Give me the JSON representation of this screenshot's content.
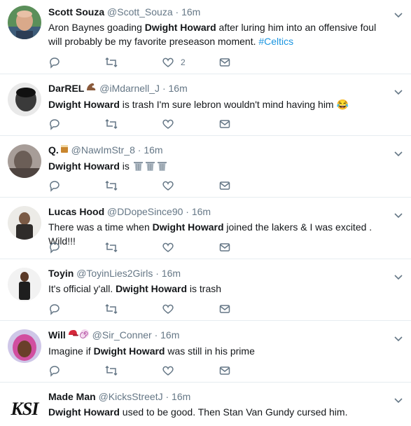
{
  "tweets": [
    {
      "name": "Scott Souza",
      "handle": "@Scott_Souza",
      "time": "16m",
      "text_parts": [
        "Aron Baynes goading ",
        "Dwight Howard",
        " after luring him into an offensive foul will probably be my favorite preseason moment. ",
        "#Celtics"
      ],
      "like_count": "2",
      "avatar": "avatar-bald-man"
    },
    {
      "name": "DarREL",
      "name_emoji": "muscle-emoji",
      "handle": "@iMdarnell_J",
      "time": "16m",
      "text_parts": [
        "Dwight Howard",
        " is trash I'm sure lebron wouldn't mind having him ",
        "😂"
      ],
      "avatar": "avatar-bw-man"
    },
    {
      "name": "Q.",
      "name_emoji": "drink-emoji",
      "handle": "@NawImStr_8",
      "time": "16m",
      "text_parts": [
        "Dwight Howard",
        " is "
      ],
      "trash_emoji_count": 3,
      "avatar": "avatar-blurry-man"
    },
    {
      "name": "Lucas Hood",
      "handle": "@DDopeSince90",
      "time": "16m",
      "text_parts": [
        "There was a time when ",
        "Dwight Howard",
        " joined the lakers & I was excited . Wild!!!"
      ],
      "avatar": "avatar-seated-man"
    },
    {
      "name": "Toyin",
      "handle": "@ToyinLies2Girls",
      "time": "16m",
      "text_parts": [
        "It's official y'all. ",
        "Dwight Howard",
        " is trash"
      ],
      "avatar": "avatar-standing-man"
    },
    {
      "name": "Will",
      "name_emoji": "baseball-cap-emoji",
      "handle": "@Sir_Conner",
      "time": "16m",
      "text_parts": [
        "Imagine if ",
        "Dwight Howard",
        " was still in his prime"
      ],
      "avatar": "avatar-pink-hood"
    },
    {
      "name": "Made Man",
      "handle": "@KicksStreetJ",
      "time": "16m",
      "text_parts": [
        "Dwight Howard",
        " used to be good. Then Stan Van Gundy cursed him."
      ],
      "avatar_text": "KSI"
    }
  ],
  "colors": {
    "text": "#14171a",
    "secondary": "#657786",
    "link": "#1b95e0",
    "divider": "#e6ecf0"
  },
  "icons": {
    "reply": "reply-icon",
    "retweet": "retweet-icon",
    "like": "heart-icon",
    "dm": "envelope-icon",
    "more": "chevron-down-icon"
  }
}
